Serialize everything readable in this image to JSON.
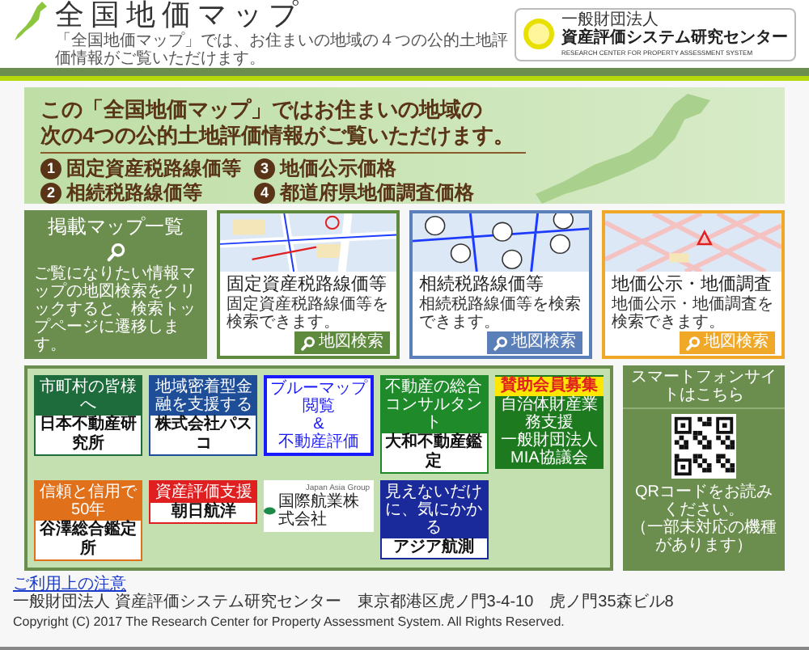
{
  "header": {
    "title": "全国地価マップ",
    "subtitle": "「全国地価マップ」では、お住まいの地域の４つの公的土地評価情報がご覧いただけます。",
    "org_logo": {
      "prefix": "一般財団法人",
      "name": "資産評価システム研究センター",
      "english": "RESEARCH CENTER FOR PROPERTY ASSESSMENT SYSTEM"
    }
  },
  "intro": {
    "lines": [
      "この「全国地価マップ」ではお住まいの地域の",
      "次の4つの公的土地評価情報がご覧いただけます。"
    ],
    "items": [
      {
        "number": "1",
        "label": "固定資産税路線価等"
      },
      {
        "number": "3",
        "label": "地価公示価格"
      },
      {
        "number": "2",
        "label": "相続税路線価等"
      },
      {
        "number": "4",
        "label": "都道府県地価調査価格"
      }
    ]
  },
  "map_list": {
    "title": "掲載マップ一覧",
    "description": "ご覧になりたい情報マップの地図検索をクリックすると、検索トップページに遷移します。"
  },
  "map_cards": [
    {
      "kind": "roads",
      "title": "固定資産税路線価等",
      "description": "固定資産税路線価等を検索できます。",
      "button": "地図検索",
      "color": "#5d8a3c"
    },
    {
      "kind": "circles",
      "title": "相続税路線価等",
      "description": "相続税路線価等を検索できます。",
      "button": "地図検索",
      "color": "#5b7fb8"
    },
    {
      "kind": "grid",
      "title": "地価公示・地価調査",
      "description": "地価公示・地価調査を検索できます。",
      "button": "地図検索",
      "color": "#f0a828"
    }
  ],
  "sponsors": [
    {
      "kind": "split",
      "top": "市町村の皆様へ",
      "bottom": "日本不動産研究所",
      "color": "#1e6b3c"
    },
    {
      "kind": "split",
      "top": "地域密着型金融を支援する",
      "bottom": "株式会社パスコ",
      "color": "#1f4e99"
    },
    {
      "kind": "framed",
      "lines": [
        "ブルーマップ閲覧",
        "&",
        "不動産評価"
      ],
      "color": "#1a1aff"
    },
    {
      "kind": "split",
      "top": "不動産の総合コンサルタント",
      "bottom": "大和不動産鑑定",
      "color": "#1e8a2a"
    },
    {
      "kind": "notice",
      "lines": [
        "賛助会員募集",
        "自治体財産業務支援",
        "一般財団法人MIA協議会"
      ],
      "color": "#1e7a1e"
    },
    {
      "kind": "split",
      "top": "信頼と信用で50年",
      "bottom": "谷澤総合鑑定所",
      "color": "#e0701a"
    },
    {
      "kind": "split",
      "top": "資産評価支援",
      "bottom": "朝日航洋",
      "color": "#e02020"
    },
    {
      "kind": "logo",
      "small": "Japan Asia Group",
      "name": "国際航業株式会社",
      "color": "#1e8a4a"
    },
    {
      "kind": "split",
      "top": "見えないだけに、気にかかる",
      "bottom": "アジア航測",
      "color": "#1a2a9a"
    }
  ],
  "smartphone": {
    "title": "スマートフォンサイトはこちら",
    "notes": [
      "QRコードをお読みください。",
      "（一部未対応の機種があります）"
    ]
  },
  "footer": {
    "link": "ご利用上の注意",
    "address": "一般財団法人 資産評価システム研究センター　東京都港区虎ノ門3-4-10　虎ノ門35森ビル8",
    "copyright": "Copyright (C) 2017 The Research Center for Property Assessment System. All Rights Reserved."
  }
}
